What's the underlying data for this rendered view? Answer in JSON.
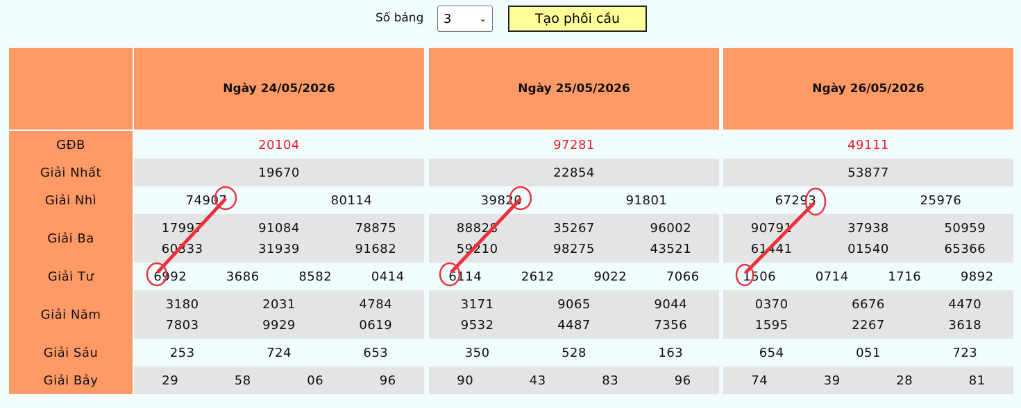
{
  "controls": {
    "board_count_label": "Số bảng",
    "board_count_value": "3",
    "build_button": "Tạo phôi cầu"
  },
  "row_labels": [
    "GĐB",
    "Giải Nhất",
    "Giải Nhì",
    "Giải Ba",
    "Giải Tư",
    "Giải Năm",
    "Giải Sáu",
    "Giải Bảy"
  ],
  "panels": [
    {
      "date": "Ngày 24/05/2026",
      "gdb": "20104",
      "nhat": "19670",
      "nhi": [
        "74907",
        "80114"
      ],
      "ba": [
        [
          "17997",
          "91084",
          "78875"
        ],
        [
          "60333",
          "31939",
          "91682"
        ]
      ],
      "tu": [
        "6992",
        "3686",
        "8582",
        "0414"
      ],
      "nam": [
        [
          "3180",
          "2031",
          "4784"
        ],
        [
          "7803",
          "9929",
          "0619"
        ]
      ],
      "sau": [
        "253",
        "724",
        "653"
      ],
      "bay": [
        "29",
        "58",
        "06",
        "96"
      ]
    },
    {
      "date": "Ngày 25/05/2026",
      "gdb": "97281",
      "nhat": "22854",
      "nhi": [
        "39820",
        "91801"
      ],
      "ba": [
        [
          "88828",
          "35267",
          "96002"
        ],
        [
          "59210",
          "98275",
          "43521"
        ]
      ],
      "tu": [
        "6114",
        "2612",
        "9022",
        "7066"
      ],
      "nam": [
        [
          "3171",
          "9065",
          "9044"
        ],
        [
          "9532",
          "4487",
          "7356"
        ]
      ],
      "sau": [
        "350",
        "528",
        "163"
      ],
      "bay": [
        "90",
        "43",
        "83",
        "96"
      ]
    },
    {
      "date": "Ngày 26/05/2026",
      "gdb": "49111",
      "nhat": "53877",
      "nhi": [
        "67293",
        "25976"
      ],
      "ba": [
        [
          "90791",
          "37938",
          "50959"
        ],
        [
          "61441",
          "01540",
          "65366"
        ]
      ],
      "tu": [
        "1506",
        "0714",
        "1716",
        "9892"
      ],
      "nam": [
        [
          "0370",
          "6676",
          "4470"
        ],
        [
          "1595",
          "2267",
          "3618"
        ]
      ],
      "sau": [
        "654",
        "051",
        "723"
      ],
      "bay": [
        "74",
        "39",
        "28",
        "81"
      ]
    }
  ],
  "colors": {
    "header": "#ff9966",
    "special_prize": "#e8202e",
    "annotation": "#e8333f",
    "button": "#ffff99"
  }
}
